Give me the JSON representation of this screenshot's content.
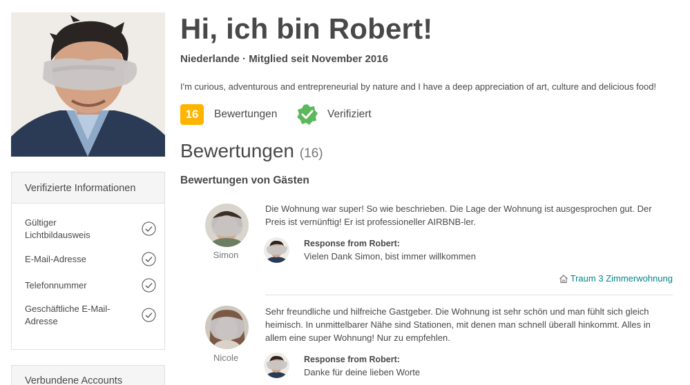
{
  "profile": {
    "greeting": "Hi, ich bin Robert!",
    "subtitle": "Niederlande · Mitglied seit November 2016",
    "about": "I'm curious, adventurous and entrepreneurial by nature and I have a deep appreciation of art, culture and delicious food!",
    "review_count": "16",
    "reviews_label": "Bewertungen",
    "verified_label": "Verifiziert"
  },
  "sidebar": {
    "verified_title": "Verifizierte Informationen",
    "verified_items": [
      {
        "label": "Gültiger Lichtbildausweis"
      },
      {
        "label": "E-Mail-Adresse"
      },
      {
        "label": "Telefonnummer"
      },
      {
        "label": "Geschäftliche E-Mail-Adresse"
      }
    ],
    "connected_title": "Verbundene Accounts"
  },
  "reviews": {
    "title": "Bewertungen",
    "count": "(16)",
    "guest_heading": "Bewertungen von Gästen",
    "items": [
      {
        "name": "Simon",
        "text": "Die Wohnung war super! So wie beschrieben. Die Lage der Wohnung ist ausgesprochen gut. Der Preis ist vernünftig! Er ist professioneller AIRBNB-ler.",
        "response_title": "Response from Robert:",
        "response_text": "Vielen Dank Simon, bist immer willkommen",
        "listing": "Traum 3 Zimmerwohnung"
      },
      {
        "name": "Nicole",
        "text": "Sehr freundliche und hilfreiche Gastgeber. Die Wohnung ist sehr schön und man fühlt sich gleich heimisch. In unmittelbarer Nähe sind Stationen, mit denen man schnell überall hinkommt. Alles in allem eine super Wohnung! Nur zu empfehlen.",
        "response_title": "Response from Robert:",
        "response_text": "Danke für deine lieben Worte"
      }
    ]
  },
  "colors": {
    "badge": "#ffb400",
    "verified_green": "#5cb85c",
    "link": "#008489",
    "text": "#484848"
  },
  "icons": {
    "verified": "verified-shield-check-icon",
    "check": "check-circle-icon",
    "listing": "home-icon"
  }
}
